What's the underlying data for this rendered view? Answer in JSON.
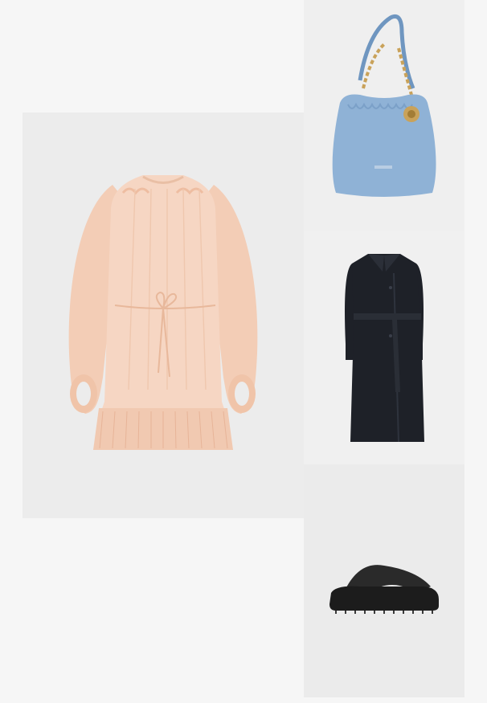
{
  "outfit": {
    "items": [
      {
        "id": "dress",
        "icon": "dress-image"
      },
      {
        "id": "bag",
        "icon": "bag-image"
      },
      {
        "id": "coat",
        "icon": "coat-image"
      },
      {
        "id": "sandal",
        "icon": "sandal-image"
      }
    ],
    "colors": {
      "page_background": "#f6f6f6",
      "dress": "#f6d6c3",
      "bag": "#8fb2d6",
      "bag_chain": "#c9a25a",
      "coat": "#1e2128",
      "sandal": "#1c1c1c"
    }
  }
}
